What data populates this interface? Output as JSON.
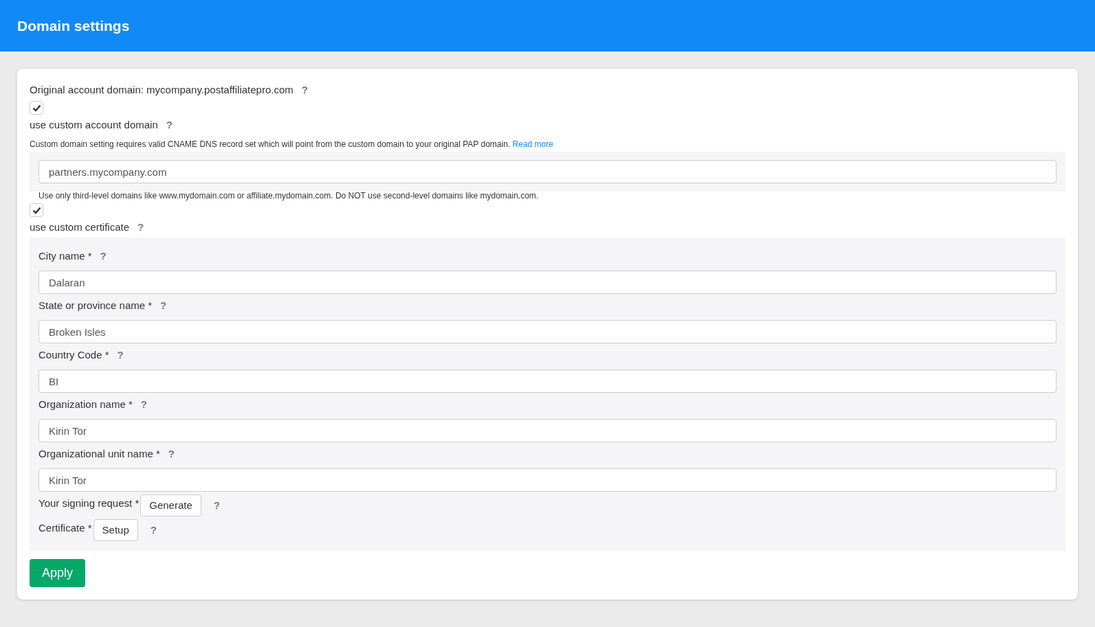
{
  "header": {
    "title": "Domain settings"
  },
  "original_domain": {
    "label": "Original account domain: mycompany.postaffiliatepro.com",
    "help": "?"
  },
  "custom_domain": {
    "checked": true,
    "label": "use custom account domain",
    "help": "?",
    "note": "Custom domain setting requires valid CNAME DNS record set which will point from the custom domain to your original PAP domain.",
    "note_link": "Read more",
    "value": "partners.mycompany.com",
    "hint": "Use only third-level domains like www.mydomain.com or affiliate.mydomain.com. Do NOT use second-level domains like mydomain.com."
  },
  "custom_certificate": {
    "checked": true,
    "label": "use custom certificate",
    "help": "?",
    "fields": [
      {
        "label": "City name *",
        "help": "?",
        "value": "Dalaran"
      },
      {
        "label": "State or province name *",
        "help": "?",
        "value": "Broken Isles"
      },
      {
        "label": "Country Code *",
        "help": "?",
        "value": "BI"
      },
      {
        "label": "Organization name *",
        "help": "?",
        "value": "Kirin Tor"
      },
      {
        "label": "Organizational unit name *",
        "help": "?",
        "value": "Kirin Tor"
      }
    ],
    "actions": [
      {
        "label": "Your signing request *",
        "button": "Generate",
        "help": "?"
      },
      {
        "label": "Certificate *",
        "button": "Setup",
        "help": "?"
      }
    ]
  },
  "apply_button": "Apply"
}
